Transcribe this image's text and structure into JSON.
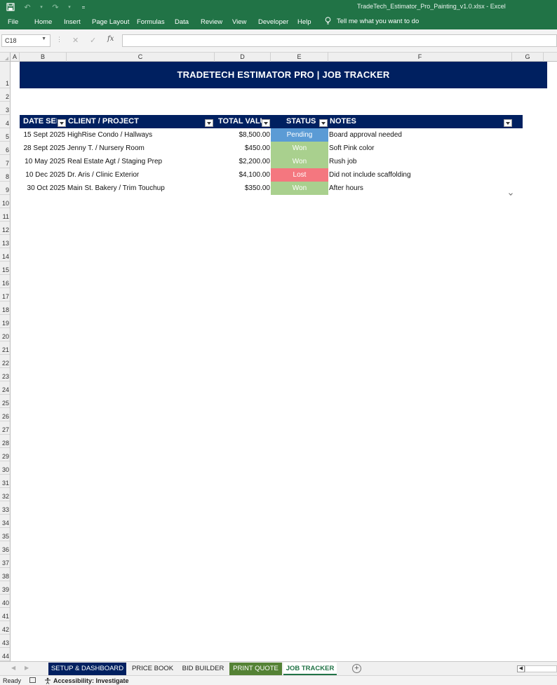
{
  "window": {
    "title": "TradeTech_Estimator_Pro_Painting_v1.0.xlsx  -  Excel"
  },
  "ribbon": {
    "tabs": [
      "File",
      "Home",
      "Insert",
      "Page Layout",
      "Formulas",
      "Data",
      "Review",
      "View",
      "Developer",
      "Help"
    ],
    "tell_me": "Tell me what you want to do"
  },
  "formula_bar": {
    "name_box": "C18",
    "fx_label": "fx",
    "value": ""
  },
  "columns": [
    "A",
    "B",
    "C",
    "D",
    "E",
    "F",
    "G"
  ],
  "rows": [
    1,
    2,
    3,
    4,
    5,
    6,
    7,
    8,
    9,
    10,
    11,
    12,
    13,
    14,
    15,
    16,
    17,
    18,
    19,
    20,
    21,
    22,
    23,
    24,
    25,
    26,
    27,
    28,
    29,
    30,
    31,
    32,
    33,
    34,
    35,
    36,
    37,
    38,
    39,
    40,
    41,
    42,
    43,
    44
  ],
  "sheet": {
    "banner_title": "TRADETECH ESTIMATOR PRO | JOB TRACKER",
    "table": {
      "headers": {
        "date": "DATE SENT",
        "client": "CLIENT / PROJECT",
        "value": "TOTAL VALUE",
        "status": "STATUS",
        "notes": "NOTES"
      },
      "rows": [
        {
          "date": "15 Sept 2025",
          "client": "HighRise Condo / Hallways",
          "value": "$8,500.00",
          "status": "Pending",
          "status_color": "#5b9bd5",
          "notes": "Board approval needed"
        },
        {
          "date": "28 Sept 2025",
          "client": "Jenny T. / Nursery Room",
          "value": "$450.00",
          "status": "Won",
          "status_color": "#a9d08e",
          "notes": "Soft Pink color"
        },
        {
          "date": "10 May 2025",
          "client": "Real Estate Agt / Staging Prep",
          "value": "$2,200.00",
          "status": "Won",
          "status_color": "#a9d08e",
          "notes": "Rush job"
        },
        {
          "date": "10 Dec 2025",
          "client": "Dr. Aris / Clinic Exterior",
          "value": "$4,100.00",
          "status": "Lost",
          "status_color": "#f4777f",
          "notes": "Did not include scaffolding"
        },
        {
          "date": "30 Oct 2025",
          "client": "Main St. Bakery / Trim Touchup",
          "value": "$350.00",
          "status": "Won",
          "status_color": "#a9d08e",
          "notes": "After hours"
        }
      ]
    }
  },
  "sheet_tabs": [
    {
      "label": "SETUP & DASHBOARD",
      "bg": "#002060",
      "color": "#ffffff"
    },
    {
      "label": "PRICE BOOK",
      "bg": "",
      "color": "#222222"
    },
    {
      "label": "BID BUILDER",
      "bg": "",
      "color": "#222222"
    },
    {
      "label": "PRINT QUOTE",
      "bg": "#548235",
      "color": "#ffffff"
    },
    {
      "label": "JOB TRACKER",
      "bg": "#ffffff",
      "color": "#217346",
      "active": true
    }
  ],
  "status_bar": {
    "ready": "Ready",
    "accessibility": "Accessibility: Investigate"
  }
}
